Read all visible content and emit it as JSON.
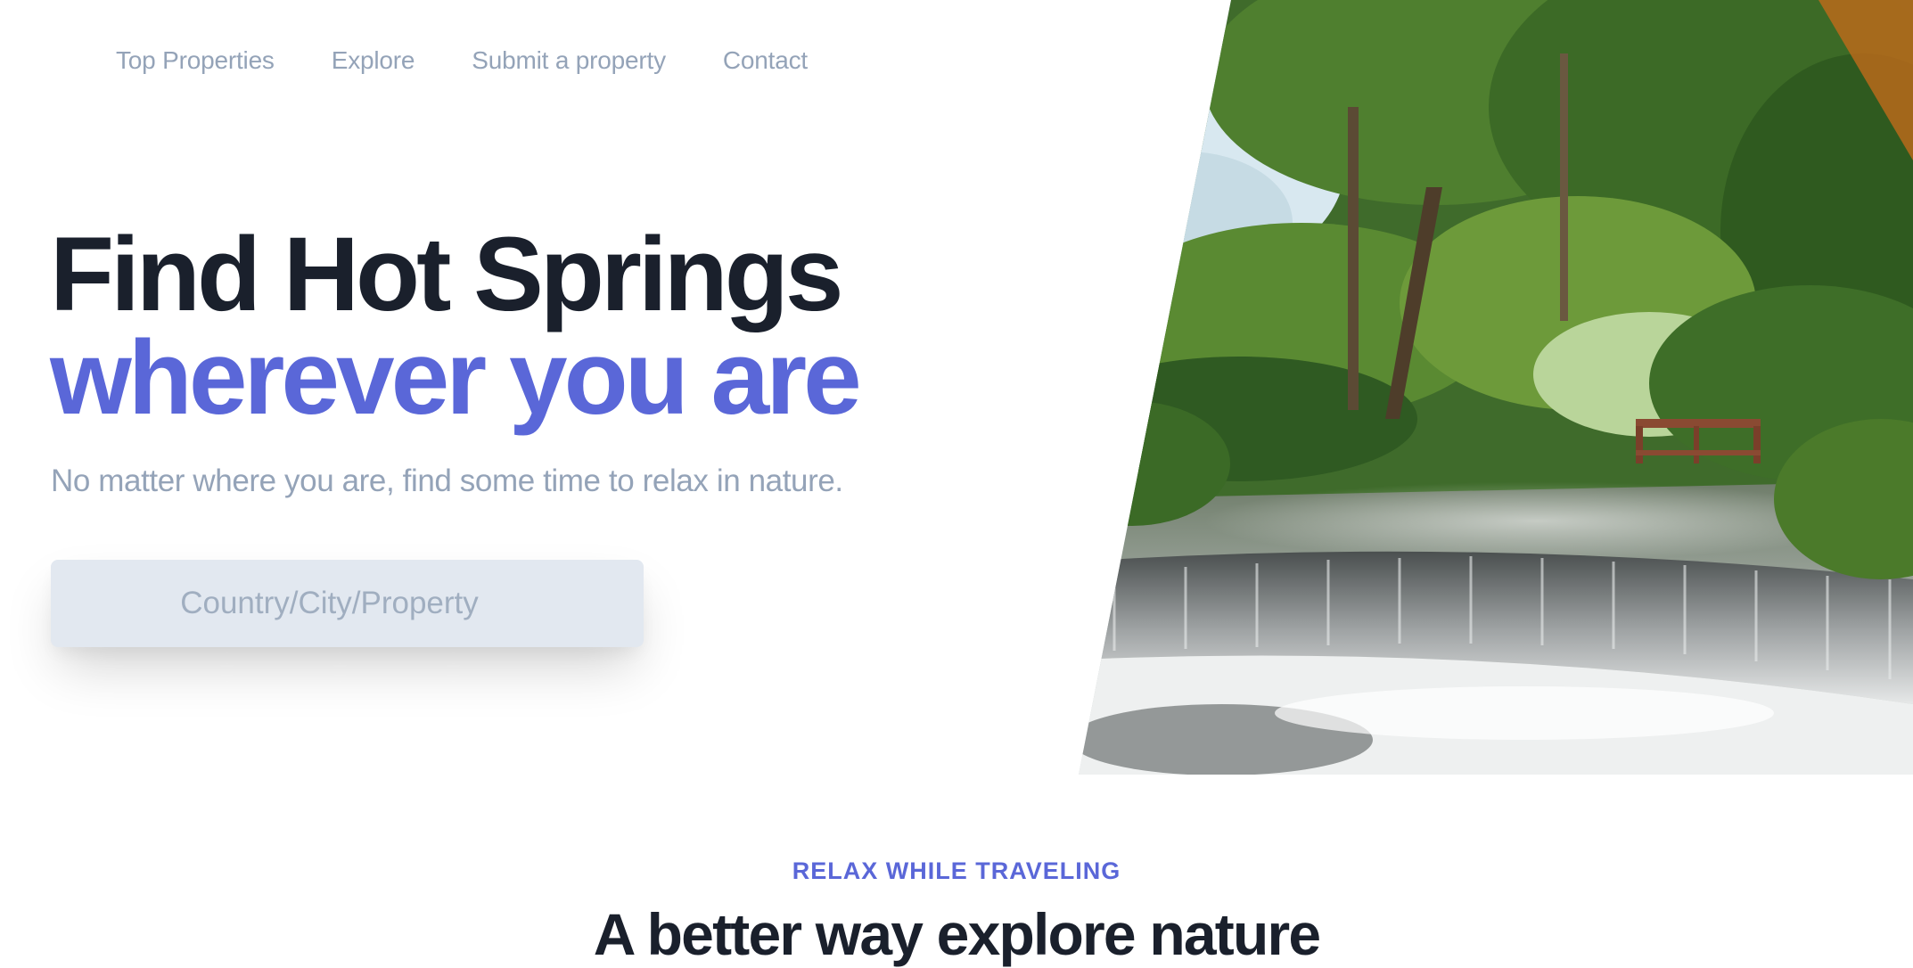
{
  "nav": {
    "items": [
      {
        "label": "Top Properties"
      },
      {
        "label": "Explore"
      },
      {
        "label": "Submit a property"
      },
      {
        "label": "Contact"
      }
    ]
  },
  "hero": {
    "title_line1": "Find Hot Springs",
    "title_line2": "wherever you are",
    "subtitle": "No matter where you are, find some time to relax in nature.",
    "search_placeholder": "Country/City/Property",
    "search_value": ""
  },
  "section": {
    "eyebrow": "Relax while traveling",
    "title": "A better way explore nature"
  },
  "colors": {
    "accent": "#5a67d8",
    "heading": "#1a202c",
    "muted": "#94a3b8",
    "input_bg": "#e2e8f0"
  }
}
